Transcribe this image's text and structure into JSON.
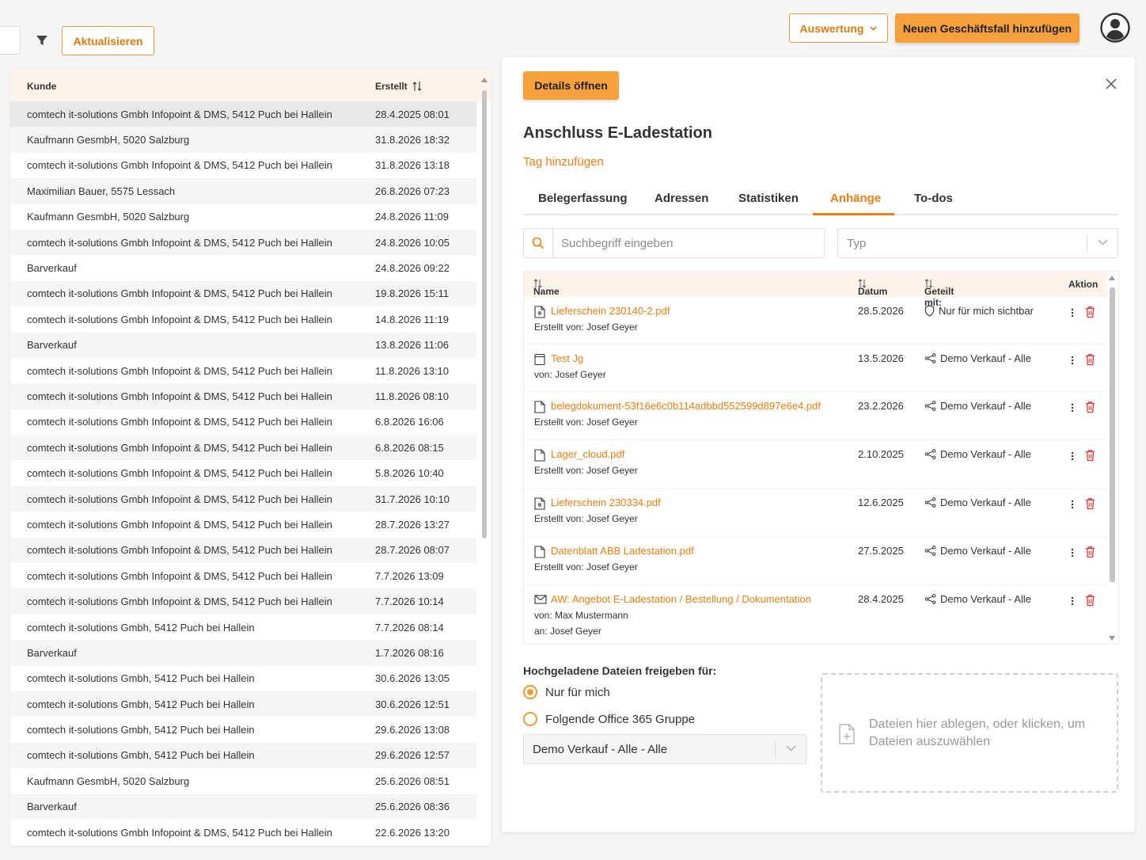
{
  "toolbar": {
    "refresh_label": "Aktualisieren",
    "evaluation_label": "Auswertung",
    "add_case_label": "Neuen Geschäftsfall hinzufügen"
  },
  "list": {
    "columns": {
      "customer": "Kunde",
      "created": "Erstellt"
    },
    "rows": [
      {
        "kunde": "comtech it-solutions Gmbh Infopoint & DMS, 5412 Puch bei Hallein",
        "erstellt": "28.4.2025 08:01"
      },
      {
        "kunde": "Kaufmann GesmbH, 5020 Salzburg",
        "erstellt": "31.8.2026 18:32"
      },
      {
        "kunde": "comtech it-solutions Gmbh Infopoint & DMS, 5412 Puch bei Hallein",
        "erstellt": "31.8.2026 13:18"
      },
      {
        "kunde": "Maximilian Bauer, 5575 Lessach",
        "erstellt": "26.8.2026 07:23"
      },
      {
        "kunde": "Kaufmann GesmbH, 5020 Salzburg",
        "erstellt": "24.8.2026 11:09"
      },
      {
        "kunde": "comtech it-solutions Gmbh Infopoint & DMS, 5412 Puch bei Hallein",
        "erstellt": "24.8.2026 10:05"
      },
      {
        "kunde": "Barverkauf",
        "erstellt": "24.8.2026 09:22"
      },
      {
        "kunde": "comtech it-solutions Gmbh Infopoint & DMS, 5412 Puch bei Hallein",
        "erstellt": "19.8.2026 15:11"
      },
      {
        "kunde": "comtech it-solutions Gmbh Infopoint & DMS, 5412 Puch bei Hallein",
        "erstellt": "14.8.2026 11:19"
      },
      {
        "kunde": "Barverkauf",
        "erstellt": "13.8.2026 11:06"
      },
      {
        "kunde": "comtech it-solutions Gmbh Infopoint & DMS, 5412 Puch bei Hallein",
        "erstellt": "11.8.2026 13:10"
      },
      {
        "kunde": "comtech it-solutions Gmbh Infopoint & DMS, 5412 Puch bei Hallein",
        "erstellt": "11.8.2026 08:10"
      },
      {
        "kunde": "comtech it-solutions Gmbh Infopoint & DMS, 5412 Puch bei Hallein",
        "erstellt": "6.8.2026 16:06"
      },
      {
        "kunde": "comtech it-solutions Gmbh Infopoint & DMS, 5412 Puch bei Hallein",
        "erstellt": "6.8.2026 08:15"
      },
      {
        "kunde": "comtech it-solutions Gmbh Infopoint & DMS, 5412 Puch bei Hallein",
        "erstellt": "5.8.2026 10:40"
      },
      {
        "kunde": "comtech it-solutions Gmbh Infopoint & DMS, 5412 Puch bei Hallein",
        "erstellt": "31.7.2026 10:10"
      },
      {
        "kunde": "comtech it-solutions Gmbh Infopoint & DMS, 5412 Puch bei Hallein",
        "erstellt": "28.7.2026 13:27"
      },
      {
        "kunde": "comtech it-solutions Gmbh Infopoint & DMS, 5412 Puch bei Hallein",
        "erstellt": "28.7.2026 08:07"
      },
      {
        "kunde": "comtech it-solutions Gmbh Infopoint & DMS, 5412 Puch bei Hallein",
        "erstellt": "7.7.2026 13:09"
      },
      {
        "kunde": "comtech it-solutions Gmbh Infopoint & DMS, 5412 Puch bei Hallein",
        "erstellt": "7.7.2026 10:14"
      },
      {
        "kunde": "comtech it-solutions Gmbh, 5412 Puch bei Hallein",
        "erstellt": "7.7.2026 08:14"
      },
      {
        "kunde": "Barverkauf",
        "erstellt": "1.7.2026 08:16"
      },
      {
        "kunde": "comtech it-solutions Gmbh, 5412 Puch bei Hallein",
        "erstellt": "30.6.2026 13:05"
      },
      {
        "kunde": "comtech it-solutions Gmbh, 5412 Puch bei Hallein",
        "erstellt": "30.6.2026 12:51"
      },
      {
        "kunde": "comtech it-solutions Gmbh, 5412 Puch bei Hallein",
        "erstellt": "29.6.2026 13:08"
      },
      {
        "kunde": "comtech it-solutions Gmbh, 5412 Puch bei Hallein",
        "erstellt": "29.6.2026 12:57"
      },
      {
        "kunde": "Kaufmann GesmbH, 5020 Salzburg",
        "erstellt": "25.6.2026 08:51"
      },
      {
        "kunde": "Barverkauf",
        "erstellt": "25.6.2026 08:36"
      },
      {
        "kunde": "comtech it-solutions Gmbh Infopoint & DMS, 5412 Puch bei Hallein",
        "erstellt": "22.6.2026 13:20"
      }
    ]
  },
  "detail": {
    "open_details_label": "Details öffnen",
    "title": "Anschluss E-Ladestation",
    "add_tag_label": "Tag hinzufügen",
    "tabs": [
      "Belegerfassung",
      "Adressen",
      "Statistiken",
      "Anhänge",
      "To-dos"
    ],
    "active_tab": "Anhänge",
    "search_placeholder": "Suchbegriff eingeben",
    "type_placeholder": "Typ",
    "attachments": {
      "columns": {
        "name": "Name",
        "date": "Datum",
        "shared": "Geteilt mit:",
        "action": "Aktion"
      },
      "rows": [
        {
          "icon": "pdf-file-icon",
          "name": "Lieferschein 230140-2.pdf",
          "sub1": "Erstellt von: Josef Geyer",
          "sub2": "",
          "date": "28.5.2026",
          "share_icon": "shield-icon",
          "shared": "Nur für mich sichtbar"
        },
        {
          "icon": "note-icon",
          "name": "Test Jg",
          "sub1": "von: Josef Geyer",
          "sub2": "",
          "date": "13.5.2026",
          "share_icon": "share-icon",
          "shared": "Demo Verkauf - Alle"
        },
        {
          "icon": "file-icon",
          "name": "belegdokument-53f16e6c0b114adbbd552599d897e6e4.pdf",
          "sub1": "Erstellt von: Josef Geyer",
          "sub2": "",
          "date": "23.2.2026",
          "share_icon": "share-icon",
          "shared": "Demo Verkauf - Alle"
        },
        {
          "icon": "file-icon",
          "name": "Lager_cloud.pdf",
          "sub1": "Erstellt von: Josef Geyer",
          "sub2": "",
          "date": "2.10.2025",
          "share_icon": "share-icon",
          "shared": "Demo Verkauf - Alle"
        },
        {
          "icon": "pdf-file-icon",
          "name": "Lieferschein 230334.pdf",
          "sub1": "Erstellt von: Josef Geyer",
          "sub2": "",
          "date": "12.6.2025",
          "share_icon": "share-icon",
          "shared": "Demo Verkauf - Alle"
        },
        {
          "icon": "file-icon",
          "name": "Datenblatt ABB Ladestation.pdf",
          "sub1": "Erstellt von: Josef Geyer",
          "sub2": "",
          "date": "27.5.2025",
          "share_icon": "share-icon",
          "shared": "Demo Verkauf - Alle"
        },
        {
          "icon": "mail-icon",
          "name": "AW: Angebot E-Ladestation / Bestellung / Dokumentation",
          "sub1": "von: Max Mustermann",
          "sub2": "an: Josef Geyer",
          "date": "28.4.2025",
          "share_icon": "share-icon",
          "shared": "Demo Verkauf - Alle"
        }
      ]
    },
    "share_uploads_label": "Hochgeladene Dateien freigeben für:",
    "radio_only_me": "Nur für mich",
    "radio_group": "Folgende Office 365 Gruppe",
    "group_select_value": "Demo Verkauf - Alle - Alle",
    "dropzone_text": "Dateien hier ablegen, oder klicken, um Dateien auszuwählen"
  },
  "colors": {
    "accent": "#ef7d12",
    "primary_button": "#f7a13c",
    "header_bg": "#fdf3ea",
    "delete": "#e53935"
  }
}
